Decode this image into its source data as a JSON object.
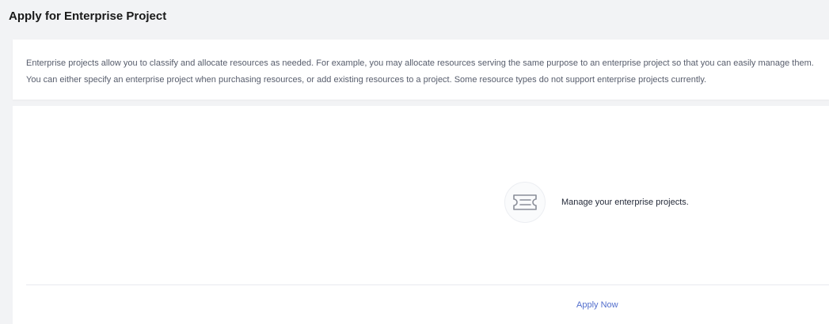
{
  "page": {
    "title": "Apply for Enterprise Project"
  },
  "intro": {
    "line1": "Enterprise projects allow you to classify and allocate resources as needed. For example, you may allocate resources serving the same purpose to an enterprise project so that you can easily manage them.",
    "line2": "You can either specify an enterprise project when purchasing resources, or add existing resources to a project. Some resource types do not support enterprise projects currently."
  },
  "empty_state": {
    "icon": "ticket-icon",
    "text": "Manage your enterprise projects."
  },
  "actions": {
    "apply_now": "Apply Now"
  },
  "colors": {
    "link": "#526ecc",
    "background": "#f2f3f5",
    "card": "#ffffff"
  }
}
